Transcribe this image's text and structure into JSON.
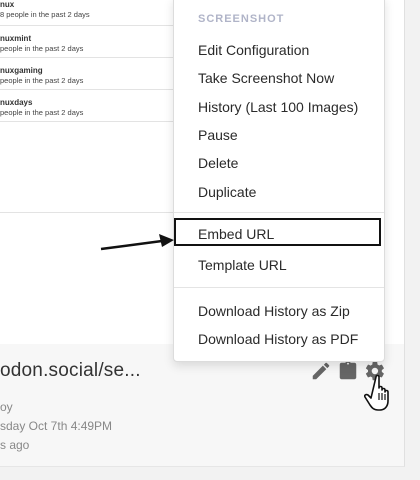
{
  "tags": [
    {
      "name": "nux",
      "sub": "8 people in the past 2 days"
    },
    {
      "name": "nuxmint",
      "sub": "people in the past 2 days"
    },
    {
      "name": "nuxgaming",
      "sub": "people in the past 2 days"
    },
    {
      "name": "nuxdays",
      "sub": "people in the past 2 days"
    }
  ],
  "panel": {
    "url_title": "odon.social/se...",
    "meta_1": "oy",
    "meta_2": "sday Oct 7th 4:49PM",
    "meta_3": "s ago"
  },
  "icons": {
    "edit": "pencil-icon",
    "clipboard": "clipboard-icon",
    "settings": "gear-icon",
    "cursor": "hand-pointer-cursor"
  },
  "menu": {
    "header": "SCREENSHOT",
    "items": [
      "Edit Configuration",
      "Take Screenshot Now",
      "History (Last 100 Images)",
      "Pause",
      "Delete",
      "Duplicate",
      "Embed URL",
      "Template URL",
      "Download History as Zip",
      "Download History as PDF"
    ]
  },
  "colors": {
    "menu_header": "#b0b4c8",
    "highlight_border": "#111111",
    "icon": "#666666"
  }
}
